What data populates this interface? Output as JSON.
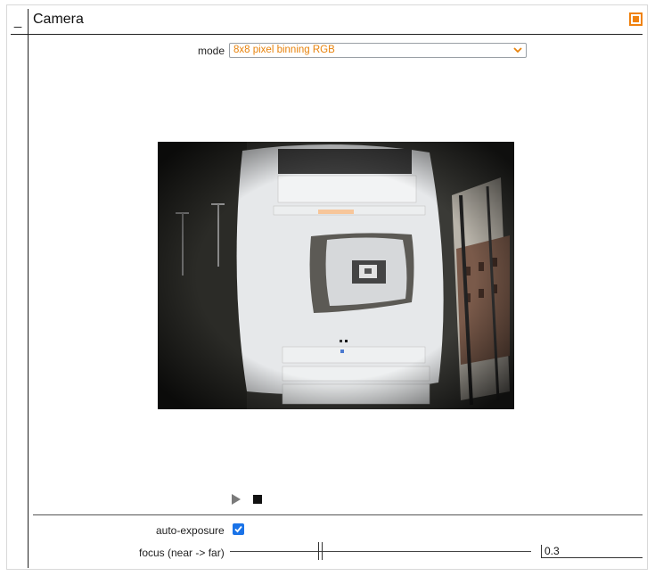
{
  "panel": {
    "title": "Camera",
    "collapse_label": "_"
  },
  "mode": {
    "label": "mode",
    "selected": "8x8 pixel binning RGB"
  },
  "playback": {
    "play_icon": "play-icon",
    "stop_icon": "stop-icon"
  },
  "auto_exposure": {
    "label": "auto-exposure",
    "checked": true
  },
  "focus": {
    "label": "focus (near -> far)",
    "value": "0.3"
  },
  "colors": {
    "accent_orange": "#f0820f",
    "checkbox_blue": "#1a73e8"
  }
}
